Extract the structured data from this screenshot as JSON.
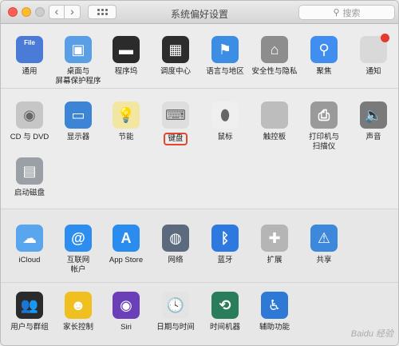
{
  "window": {
    "title": "系统偏好设置",
    "search_placeholder": "搜索"
  },
  "sections": [
    {
      "items": [
        {
          "label": "通用",
          "icon": "general-icon",
          "color": "#4a7bd6",
          "glyph": "File"
        },
        {
          "label": "桌面与\n屏幕保护程序",
          "icon": "desktop-screensaver-icon",
          "color": "#5a9ee6",
          "glyph": "▣"
        },
        {
          "label": "程序坞",
          "icon": "dock-icon",
          "color": "#2b2b2b",
          "glyph": "▬"
        },
        {
          "label": "调度中心",
          "icon": "mission-control-icon",
          "color": "#2d2d2d",
          "glyph": "▦"
        },
        {
          "label": "语言与地区",
          "icon": "language-region-icon",
          "color": "#3b8ee4",
          "glyph": "⚑"
        },
        {
          "label": "安全性与隐私",
          "icon": "security-privacy-icon",
          "color": "#8d8d8d",
          "glyph": "⌂"
        },
        {
          "label": "聚焦",
          "icon": "spotlight-icon",
          "color": "#3f8ef0",
          "glyph": "⚲"
        },
        {
          "label": "通知",
          "icon": "notifications-icon",
          "color": "#d9d9d9",
          "glyph": ""
        }
      ]
    },
    {
      "items": [
        {
          "label": "CD 与 DVD",
          "icon": "cd-dvd-icon",
          "color": "#c6c6c6",
          "glyph": "◉"
        },
        {
          "label": "显示器",
          "icon": "displays-icon",
          "color": "#3c85d6",
          "glyph": "▭"
        },
        {
          "label": "节能",
          "icon": "energy-saver-icon",
          "color": "#f3e6a0",
          "glyph": "💡"
        },
        {
          "label": "键盘",
          "icon": "keyboard-icon",
          "color": "#dedede",
          "glyph": "⌨"
        },
        {
          "label": "鼠标",
          "icon": "mouse-icon",
          "color": "#efefef",
          "glyph": "⬮"
        },
        {
          "label": "触控板",
          "icon": "trackpad-icon",
          "color": "#bdbdbd",
          "glyph": ""
        },
        {
          "label": "打印机与\n扫描仪",
          "icon": "printers-scanners-icon",
          "color": "#9a9a9a",
          "glyph": "⎙"
        },
        {
          "label": "声音",
          "icon": "sound-icon",
          "color": "#7a7a7a",
          "glyph": "🔈"
        },
        {
          "label": "启动磁盘",
          "icon": "startup-disk-icon",
          "color": "#9aa0a6",
          "glyph": "▤"
        }
      ]
    },
    {
      "items": [
        {
          "label": "iCloud",
          "icon": "icloud-icon",
          "color": "#5aa6ee",
          "glyph": "☁"
        },
        {
          "label": "互联网\n帐户",
          "icon": "internet-accounts-icon",
          "color": "#2e8ef0",
          "glyph": "@"
        },
        {
          "label": "App Store",
          "icon": "app-store-icon",
          "color": "#2b8cf0",
          "glyph": "A"
        },
        {
          "label": "网络",
          "icon": "network-icon",
          "color": "#5b6b7d",
          "glyph": "◍"
        },
        {
          "label": "蓝牙",
          "icon": "bluetooth-icon",
          "color": "#2d79e0",
          "glyph": "ᛒ"
        },
        {
          "label": "扩展",
          "icon": "extensions-icon",
          "color": "#b5b5b5",
          "glyph": "✚"
        },
        {
          "label": "共享",
          "icon": "sharing-icon",
          "color": "#3d88da",
          "glyph": "⚠"
        }
      ]
    },
    {
      "items": [
        {
          "label": "用户与群组",
          "icon": "users-groups-icon",
          "color": "#2b2b2b",
          "glyph": "👥"
        },
        {
          "label": "家长控制",
          "icon": "parental-controls-icon",
          "color": "#f0c020",
          "glyph": "☻"
        },
        {
          "label": "Siri",
          "icon": "siri-icon",
          "color": "#6a3fb8",
          "glyph": "◉"
        },
        {
          "label": "日期与时间",
          "icon": "date-time-icon",
          "color": "#e3e3e3",
          "glyph": "🕓"
        },
        {
          "label": "时间机器",
          "icon": "time-machine-icon",
          "color": "#2a7d5a",
          "glyph": "⟲"
        },
        {
          "label": "辅助功能",
          "icon": "accessibility-icon",
          "color": "#2f79d6",
          "glyph": "♿"
        }
      ]
    }
  ],
  "highlighted": "键盘",
  "watermark": "Baidu 经验"
}
